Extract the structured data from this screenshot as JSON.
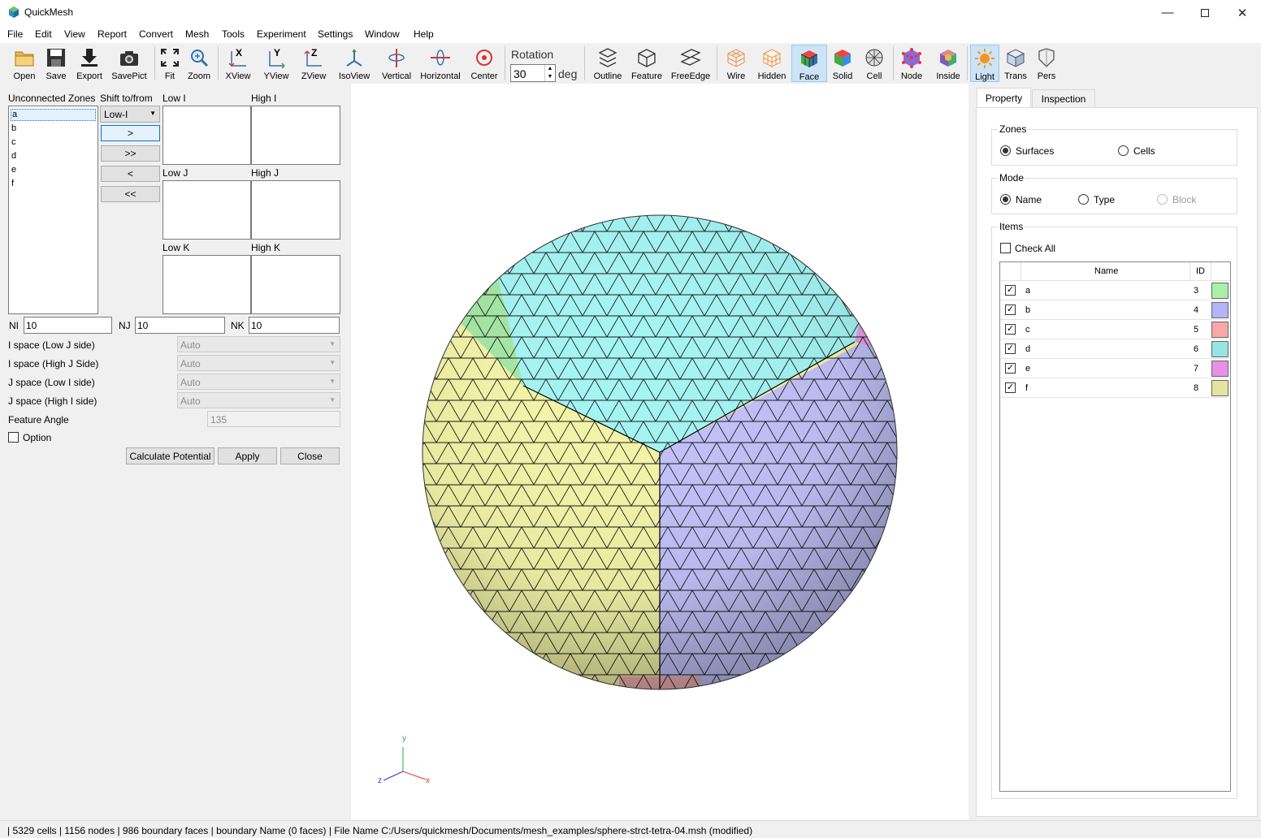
{
  "window": {
    "title": "QuickMesh"
  },
  "menu": [
    "File",
    "Edit",
    "View",
    "Report",
    "Convert",
    "Mesh",
    "Tools",
    "Experiment",
    "Settings",
    "Window",
    "Help"
  ],
  "toolbar": {
    "open": "Open",
    "save": "Save",
    "export": "Export",
    "savepict": "SavePict",
    "fit": "Fit",
    "zoom": "Zoom",
    "xview": "XView",
    "yview": "YView",
    "zview": "ZView",
    "isoview": "IsoView",
    "vertical": "Vertical",
    "horizontal": "Horizontal",
    "center": "Center",
    "rotation_label": "Rotation",
    "rotation_value": "30",
    "rotation_unit": "deg",
    "outline": "Outline",
    "feature": "Feature",
    "freeedge": "FreeEdge",
    "wire": "Wire",
    "hidden": "Hidden",
    "face": "Face",
    "solid": "Solid",
    "cell": "Cell",
    "node": "Node",
    "inside": "Inside",
    "light": "Light",
    "trans": "Trans",
    "pers": "Pers"
  },
  "left": {
    "unconnected_label": "Unconnected Zones",
    "shift_label": "Shift to/from",
    "zones": [
      "a",
      "b",
      "c",
      "d",
      "e",
      "f"
    ],
    "shift_select": "Low-I",
    "btn_move": ">",
    "btn_move_all": ">>",
    "btn_back": "<",
    "btn_back_all": "<<",
    "low_i": "Low I",
    "high_i": "High I",
    "low_j": "Low J",
    "high_j": "High J",
    "low_k": "Low K",
    "high_k": "High K",
    "ni_label": "NI",
    "ni_value": "10",
    "nj_label": "NJ",
    "nj_value": "10",
    "nk_label": "NK",
    "nk_value": "10",
    "i_space_low_j": "I space (Low J side)",
    "i_space_high_j": "I space (High J Side)",
    "j_space_low_i": "J space (Low I side)",
    "j_space_high_i": "J space (High I side)",
    "auto": "Auto",
    "feature_angle_label": "Feature Angle",
    "feature_angle_value": "135",
    "option_label": "Option",
    "calc_potential": "Calculate Potential",
    "apply": "Apply",
    "close": "Close"
  },
  "right": {
    "tab_property": "Property",
    "tab_inspection": "Inspection",
    "zones_title": "Zones",
    "surfaces": "Surfaces",
    "cells": "Cells",
    "mode_title": "Mode",
    "name": "Name",
    "type": "Type",
    "block": "Block",
    "items_title": "Items",
    "check_all": "Check All",
    "col_name": "Name",
    "col_id": "ID",
    "items": [
      {
        "name": "a",
        "id": "3",
        "color": "#a8f0a8"
      },
      {
        "name": "b",
        "id": "4",
        "color": "#b4b4f8"
      },
      {
        "name": "c",
        "id": "5",
        "color": "#f8a8a8"
      },
      {
        "name": "d",
        "id": "6",
        "color": "#98e4e4"
      },
      {
        "name": "e",
        "id": "7",
        "color": "#e890e8"
      },
      {
        "name": "f",
        "id": "8",
        "color": "#e4e4a0"
      }
    ]
  },
  "viewport": {
    "axis_x": "x",
    "axis_y": "y",
    "axis_z": "z"
  },
  "status": "| 5329 cells | 1156 nodes | 986 boundary faces |  boundary Name  (0 faces) | File Name C:/Users/quickmesh/Documents/mesh_examples/sphere-strct-tetra-04.msh (modified)"
}
